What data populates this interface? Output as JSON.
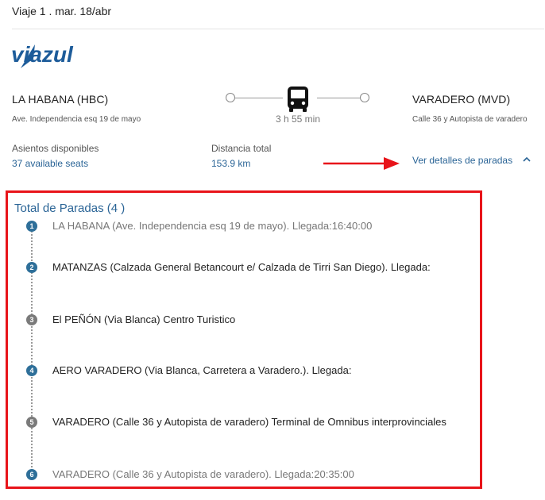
{
  "trip": {
    "title": "Viaje 1 . mar. 18/abr"
  },
  "brand": {
    "logo_text": "viazul",
    "color": "#1d5c9a"
  },
  "origin": {
    "name": "LA HABANA (HBC)",
    "address": "Ave. Independencia esq 19 de mayo"
  },
  "destination": {
    "name": "VARADERO (MVD)",
    "address": "Calle 36 y Autopista de varadero"
  },
  "route": {
    "duration": "3 h 55 min",
    "icon": "bus-icon"
  },
  "seats": {
    "label": "Asientos disponibles",
    "value": "37 available seats"
  },
  "distance": {
    "label": "Distancia total",
    "value": "153.9 km"
  },
  "details": {
    "link_label": "Ver detalles de paradas",
    "expanded": true
  },
  "stops": {
    "title": "Total de Paradas (4 )",
    "items": [
      {
        "number": "1",
        "text": "LA HABANA (Ave. Independencia esq 19 de mayo). Llegada:16:40:00",
        "style": "muted",
        "badge": "blue"
      },
      {
        "number": "2",
        "text": "MATANZAS (Calzada General Betancourt e/ Calzada de Tirri San Diego). Llegada:",
        "style": "dark",
        "badge": "blue"
      },
      {
        "number": "3",
        "text": "El PEÑÓN (Via Blanca) Centro Turistico",
        "style": "dark",
        "badge": "gray"
      },
      {
        "number": "4",
        "text": "AERO VARADERO (Via Blanca, Carretera a Varadero.). Llegada:",
        "style": "dark",
        "badge": "blue"
      },
      {
        "number": "5",
        "text": "VARADERO (Calle 36 y Autopista de varadero) Terminal de Omnibus interprovinciales",
        "style": "dark",
        "badge": "gray"
      },
      {
        "number": "6",
        "text": "VARADERO (Calle 36 y Autopista de varadero). Llegada:20:35:00",
        "style": "muted",
        "badge": "blue"
      }
    ]
  },
  "colors": {
    "link": "#2a6496",
    "highlight_box": "#e8141a",
    "badge_blue": "#2e6f99",
    "badge_gray": "#7a7a7a"
  }
}
